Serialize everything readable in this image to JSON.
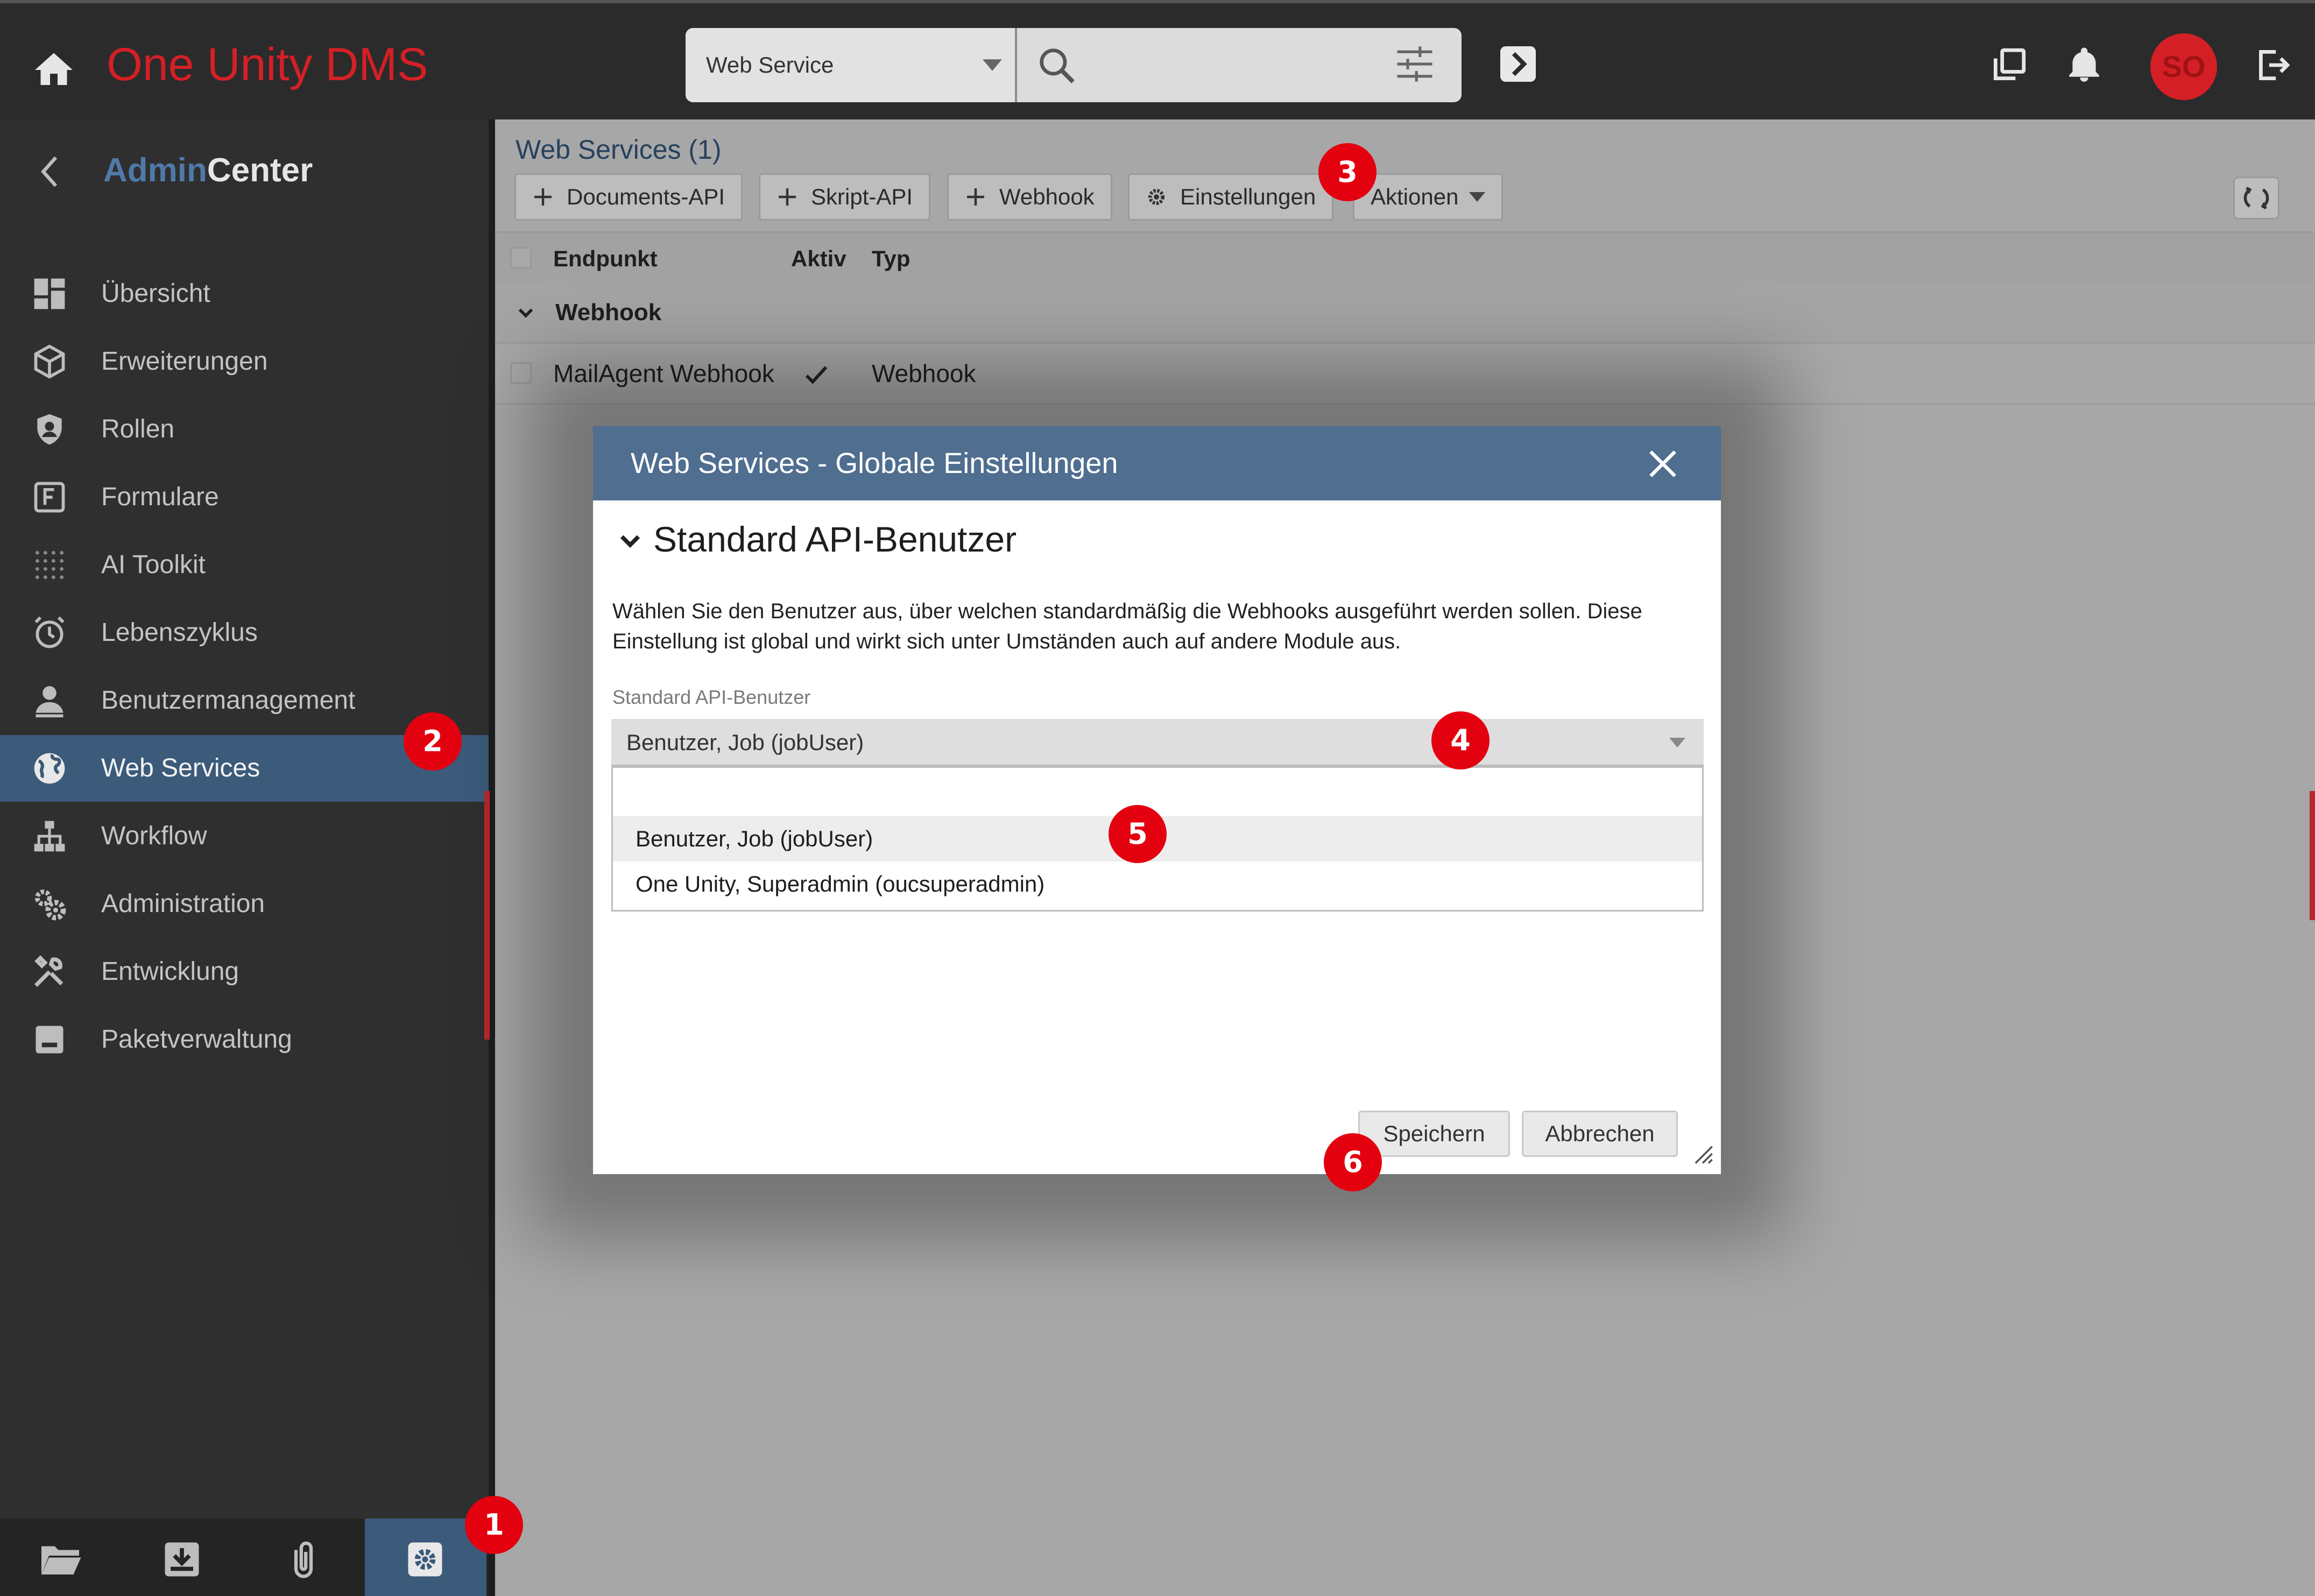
{
  "header": {
    "brand": "One Unity DMS",
    "search": {
      "scope": "Web Service",
      "value": "",
      "placeholder": ""
    },
    "avatar_initials": "SO",
    "brand_color": "#d51f26"
  },
  "sidebar": {
    "title_part1": "Admin",
    "title_part2": "Center",
    "items": [
      {
        "label": "Übersicht",
        "icon": "dashboard-icon"
      },
      {
        "label": "Erweiterungen",
        "icon": "cube-icon"
      },
      {
        "label": "Rollen",
        "icon": "shield-icon"
      },
      {
        "label": "Formulare",
        "icon": "form-icon"
      },
      {
        "label": "AI Toolkit",
        "icon": "dots-grid-icon"
      },
      {
        "label": "Lebenszyklus",
        "icon": "alarm-clock-icon"
      },
      {
        "label": "Benutzermanagement",
        "icon": "user-icon"
      },
      {
        "label": "Web Services",
        "icon": "globe-icon",
        "active": true
      },
      {
        "label": "Workflow",
        "icon": "sitemap-icon"
      },
      {
        "label": "Administration",
        "icon": "cogs-icon"
      },
      {
        "label": "Entwicklung",
        "icon": "tools-icon"
      },
      {
        "label": "Paketverwaltung",
        "icon": "package-icon"
      }
    ],
    "bottom_icons": [
      "folder-icon",
      "inbox-icon",
      "paperclip-icon",
      "settings-icon"
    ]
  },
  "main": {
    "title": "Web Services (1)",
    "toolbar": {
      "documents_api": "Documents-API",
      "skript_api": "Skript-API",
      "webhook": "Webhook",
      "einstellungen": "Einstellungen",
      "aktionen": "Aktionen"
    },
    "grid": {
      "columns": [
        "Endpunkt",
        "Aktiv",
        "Typ"
      ],
      "group": "Webhook",
      "rows": [
        {
          "endpunkt": "MailAgent Webhook",
          "aktiv": true,
          "typ": "Webhook"
        }
      ]
    }
  },
  "modal": {
    "title": "Web Services - Globale Einstellungen",
    "section_title": "Standard API-Benutzer",
    "description": "Wählen Sie den Benutzer aus, über welchen standardmäßig die Webhooks ausgeführt werden sollen. Diese Einstellung ist global und wirkt sich unter Umständen auch auf andere Module aus.",
    "field_label": "Standard API-Benutzer",
    "selected_value": "Benutzer, Job (jobUser)",
    "options": [
      "Benutzer, Job (jobUser)",
      "One Unity, Superadmin (oucsuperadmin)"
    ],
    "save_label": "Speichern",
    "cancel_label": "Abbrechen",
    "header_color": "#4f6e90"
  },
  "annotations": [
    "1",
    "2",
    "3",
    "4",
    "5",
    "6"
  ],
  "colors": {
    "active_nav": "#3c5a7a",
    "accent_red": "#d51f26",
    "badge_red": "#e3000f"
  }
}
